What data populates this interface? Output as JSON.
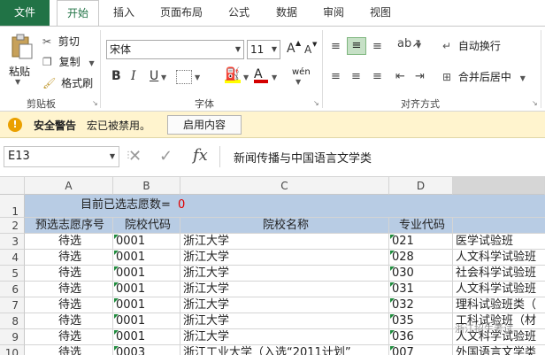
{
  "ribbon_tabs": [
    "文件",
    "开始",
    "插入",
    "页面布局",
    "公式",
    "数据",
    "审阅",
    "视图"
  ],
  "clipboard": {
    "paste": "粘贴",
    "cut": "剪切",
    "copy": "复制",
    "format_painter": "格式刷",
    "group_label": "剪贴板"
  },
  "font": {
    "name": "宋体",
    "size": "11",
    "bold": "B",
    "italic": "I",
    "underline": "U",
    "grow": "A",
    "shrink": "A",
    "phonetic": "wén",
    "group_label": "字体"
  },
  "alignment": {
    "wrap_text": "自动换行",
    "merge_center": "合并后居中",
    "group_label": "对齐方式"
  },
  "security_bar": {
    "title": "安全警告",
    "message": "宏已被禁用。",
    "button": "启用内容"
  },
  "formula_bar": {
    "name_box": "E13",
    "fx": "fx",
    "content": "新闻传播与中国语言文学类"
  },
  "columns": [
    "A",
    "B",
    "C",
    "D"
  ],
  "row_numbers": [
    "1",
    "2",
    "3",
    "4",
    "5",
    "6",
    "7",
    "8",
    "9",
    "10"
  ],
  "sheet": {
    "row1_label": "目前已选志愿数=",
    "row1_value": "0",
    "headers": [
      "预选志愿序号",
      "院校代码",
      "院校名称",
      "专业代码"
    ],
    "rows": [
      [
        "待选",
        "0001",
        "浙江大学",
        "021",
        "医学试验班"
      ],
      [
        "待选",
        "0001",
        "浙江大学",
        "028",
        "人文科学试验班"
      ],
      [
        "待选",
        "0001",
        "浙江大学",
        "030",
        "社会科学试验班"
      ],
      [
        "待选",
        "0001",
        "浙江大学",
        "031",
        "人文科学试验班"
      ],
      [
        "待选",
        "0001",
        "浙江大学",
        "032",
        "理科试验班类（"
      ],
      [
        "待选",
        "0001",
        "浙江大学",
        "035",
        "工科试验班（材"
      ],
      [
        "待选",
        "0001",
        "浙江大学",
        "036",
        "人文科学试验班"
      ],
      [
        "待选",
        "0003",
        "浙江工业大学（入选“2011计划”",
        "007",
        "外国语言文学类"
      ]
    ]
  },
  "watermark": "浙江招生考试",
  "colors": {
    "accent": "#217346",
    "header_fill": "#b8cce4",
    "warning_bar": "#fff4ce",
    "value_red": "#e00000"
  }
}
